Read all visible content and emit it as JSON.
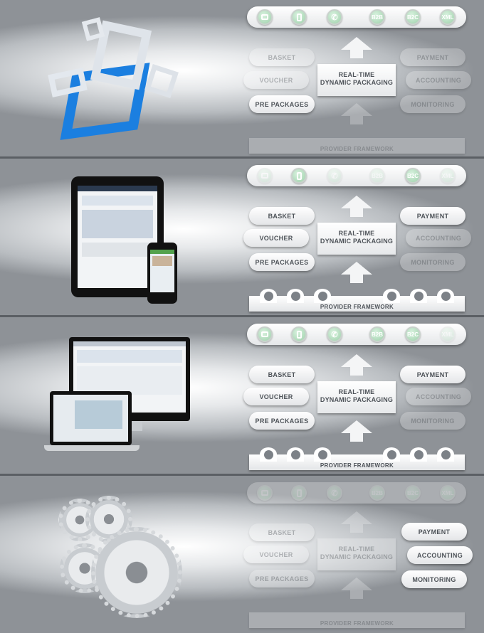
{
  "top_icons": [
    "screen-icon",
    "tablet-icon",
    "phone-icon",
    "B2B",
    "B2C",
    "XML"
  ],
  "pills_left": [
    "BASKET",
    "VOUCHER",
    "PRE PACKAGES"
  ],
  "center_label_line1": "REAL-TIME",
  "center_label_line2": "DYNAMIC PACKAGING",
  "pills_right": [
    "PAYMENT",
    "ACCOUNTING",
    "MONITORING"
  ],
  "provider_label": "PROVIDER FRAMEWORK",
  "provider_icons": [
    "plane-icon",
    "bed-icon",
    "car-icon",
    "bus-icon",
    "ticket-icon",
    "info-icon"
  ],
  "colors": {
    "accent_green": "#9fd1ac",
    "frame_blue": "#1b7fe0"
  }
}
